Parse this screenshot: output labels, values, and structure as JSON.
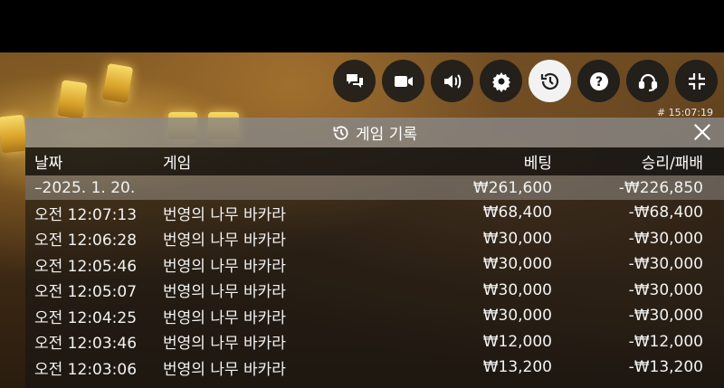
{
  "toolbar": {
    "buttons": [
      {
        "name": "chat-button",
        "icon": "chat-icon"
      },
      {
        "name": "video-button",
        "icon": "video-camera-icon"
      },
      {
        "name": "sound-button",
        "icon": "speaker-icon"
      },
      {
        "name": "settings-button",
        "icon": "gear-icon"
      },
      {
        "name": "history-button",
        "icon": "history-icon",
        "active": true
      },
      {
        "name": "help-button",
        "icon": "help-icon"
      },
      {
        "name": "support-button",
        "icon": "headset-icon"
      },
      {
        "name": "minimize-button",
        "icon": "collapse-icon"
      }
    ]
  },
  "timestamp": "# 15:07:19",
  "panel": {
    "title": "게임 기록",
    "columns": {
      "date": "날짜",
      "game": "게임",
      "bet": "베팅",
      "result": "승리/패배"
    },
    "summary": {
      "date": "–2025. 1. 20.",
      "bet": "₩261,600",
      "result": "-₩226,850"
    },
    "rows": [
      {
        "time": "오전 12:07:13",
        "game": "번영의 나무 바카라",
        "bet": "₩68,400",
        "result": "-₩68,400"
      },
      {
        "time": "오전 12:06:28",
        "game": "번영의 나무 바카라",
        "bet": "₩30,000",
        "result": "-₩30,000"
      },
      {
        "time": "오전 12:05:46",
        "game": "번영의 나무 바카라",
        "bet": "₩30,000",
        "result": "-₩30,000"
      },
      {
        "time": "오전 12:05:07",
        "game": "번영의 나무 바카라",
        "bet": "₩30,000",
        "result": "-₩30,000"
      },
      {
        "time": "오전 12:04:25",
        "game": "번영의 나무 바카라",
        "bet": "₩30,000",
        "result": "-₩30,000"
      },
      {
        "time": "오전 12:03:46",
        "game": "번영의 나무 바카라",
        "bet": "₩12,000",
        "result": "-₩12,000"
      },
      {
        "time": "오전 12:03:06",
        "game": "번영의 나무 바카라",
        "bet": "₩13,200",
        "result": "-₩13,200"
      }
    ]
  }
}
